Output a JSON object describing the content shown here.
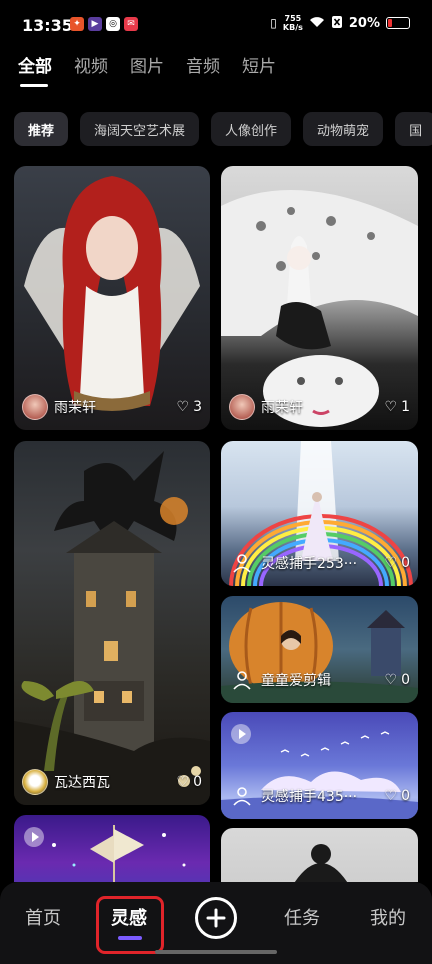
{
  "status_bar": {
    "time": "13:35",
    "speed_value": "755",
    "speed_unit": "KB/s",
    "battery": "20%"
  },
  "tabs": [
    {
      "label": "全部",
      "active": true
    },
    {
      "label": "视频"
    },
    {
      "label": "图片"
    },
    {
      "label": "音频"
    },
    {
      "label": "短片"
    }
  ],
  "chips": [
    {
      "label": "推荐",
      "active": true
    },
    {
      "label": "海阔天空艺术展"
    },
    {
      "label": "人像创作"
    },
    {
      "label": "动物萌宠"
    },
    {
      "label": "国"
    }
  ],
  "cards": [
    {
      "author": "雨茉轩",
      "likes": "3"
    },
    {
      "author": "雨茉轩",
      "likes": "1"
    },
    {
      "author": "瓦达西瓦",
      "likes": "0"
    },
    {
      "author": "灵感捕手253···",
      "likes": "0"
    },
    {
      "author": "童童爱剪辑",
      "likes": "0"
    },
    {
      "author": "灵感捕手435···",
      "likes": "0"
    }
  ],
  "bottom_nav": {
    "home": "首页",
    "inspiration": "灵感",
    "tasks": "任务",
    "mine": "我的"
  },
  "colors": {
    "accent": "#7c5cff",
    "highlight": "#e0242a",
    "background": "#000000"
  }
}
